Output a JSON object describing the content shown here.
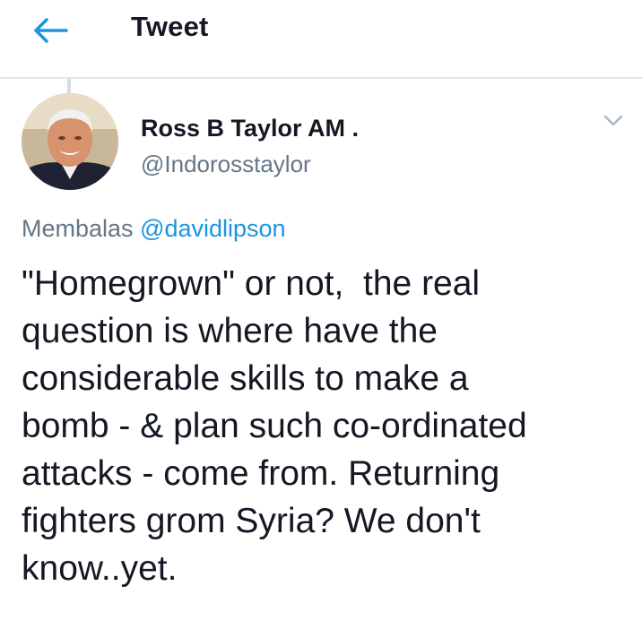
{
  "header": {
    "title": "Tweet",
    "back_icon": "arrow-left-icon",
    "accent_color": "#1b95e0"
  },
  "tweet": {
    "author_name": "Ross B Taylor AM .",
    "author_handle": "@Indorosstaylor",
    "menu_icon": "chevron-down-icon",
    "reply_prefix": "Membalas",
    "reply_handle": "@davidlipson",
    "text_lines": [
      "\"Homegrown\" or not,  the real",
      "question is where have the",
      "considerable skills to make a",
      "bomb - & plan such co-ordinated",
      "attacks - come from. Returning",
      "fighters grom Syria? We don't",
      "know..yet."
    ]
  }
}
